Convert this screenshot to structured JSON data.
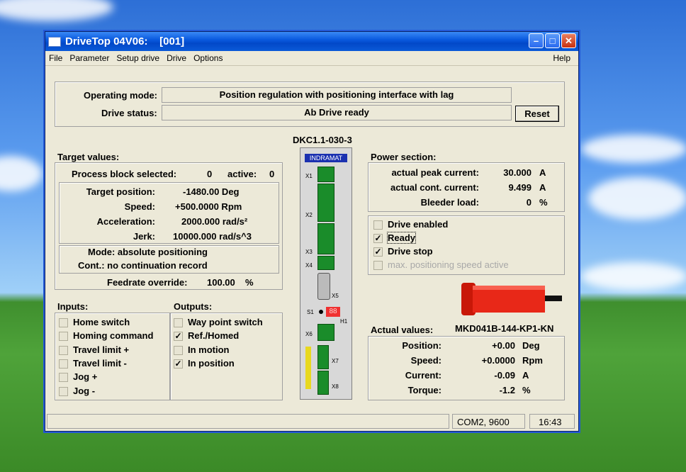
{
  "window": {
    "title": "DriveTop 04V06:    [001]"
  },
  "menu": [
    "File",
    "Parameter",
    "Setup drive",
    "Drive",
    "Options"
  ],
  "menu_help": "Help",
  "top": {
    "operating_mode_label": "Operating mode:",
    "operating_mode_value": "Position regulation with positioning interface with lag",
    "drive_status_label": "Drive status:",
    "drive_status_value": "Ab Drive ready",
    "reset_label": "Reset"
  },
  "drive_model": "DKC1.1-030-3",
  "drive_brand": "INDRAMAT",
  "drive_connectors": {
    "x1": "X1",
    "x2": "X2",
    "x3": "X3",
    "x4": "X4",
    "x5": "X5",
    "s1": "S1",
    "h1": "H1",
    "x6": "X6",
    "x7": "X7",
    "x8": "X8",
    "display": "88"
  },
  "target": {
    "section": "Target values:",
    "block_label": "Process block selected:",
    "block_value": "0",
    "active_label": "active:",
    "active_value": "0",
    "position_label": "Target position:",
    "position_value": "-1480.00 Deg",
    "speed_label": "Speed:",
    "speed_value": "+500.0000 Rpm",
    "accel_label": "Acceleration:",
    "accel_value": "2000.000 rad/s²",
    "jerk_label": "Jerk:",
    "jerk_value": "10000.000 rad/s^3",
    "mode": "Mode: absolute positioning",
    "cont": "Cont.: no continuation record",
    "feed_label": "Feedrate override:",
    "feed_value": "100.00",
    "feed_unit": "%"
  },
  "inputs": {
    "section": "Inputs:",
    "items": [
      {
        "label": "Home switch",
        "checked": false
      },
      {
        "label": "Homing command",
        "checked": false
      },
      {
        "label": "Travel limit +",
        "checked": false
      },
      {
        "label": "Travel limit -",
        "checked": false
      },
      {
        "label": "Jog +",
        "checked": false
      },
      {
        "label": "Jog -",
        "checked": false
      }
    ]
  },
  "outputs": {
    "section": "Outputs:",
    "items": [
      {
        "label": "Way point switch",
        "checked": false
      },
      {
        "label": "Ref./Homed",
        "checked": true
      },
      {
        "label": "In motion",
        "checked": false
      },
      {
        "label": "In position",
        "checked": true
      }
    ]
  },
  "power": {
    "section": "Power section:",
    "peak_label": "actual peak current:",
    "peak_value": "30.000",
    "peak_unit": "A",
    "cont_label": "actual cont. current:",
    "cont_value": "9.499",
    "cont_unit": "A",
    "bleeder_label": "Bleeder load:",
    "bleeder_value": "0",
    "bleeder_unit": "%",
    "flags": [
      {
        "label": "Drive enabled",
        "checked": false,
        "disabled": false
      },
      {
        "label": "Ready",
        "checked": true,
        "disabled": false
      },
      {
        "label": "Drive stop",
        "checked": true,
        "disabled": false
      },
      {
        "label": "max. positioning speed active",
        "checked": false,
        "disabled": true
      }
    ]
  },
  "actual": {
    "section": "Actual values:",
    "motor": "MKD041B-144-KP1-KN",
    "position_label": "Position:",
    "position_value": "+0.00",
    "position_unit": "Deg",
    "speed_label": "Speed:",
    "speed_value": "+0.0000",
    "speed_unit": "Rpm",
    "current_label": "Current:",
    "current_value": "-0.09",
    "current_unit": "A",
    "torque_label": "Torque:",
    "torque_value": "-1.2",
    "torque_unit": "%"
  },
  "statusbar": {
    "port": "COM2, 9600",
    "time": "16:43"
  },
  "colors": {
    "motor": "#e82818",
    "title_bar": "#0a5ae0",
    "connector": "#1a8c2a"
  }
}
